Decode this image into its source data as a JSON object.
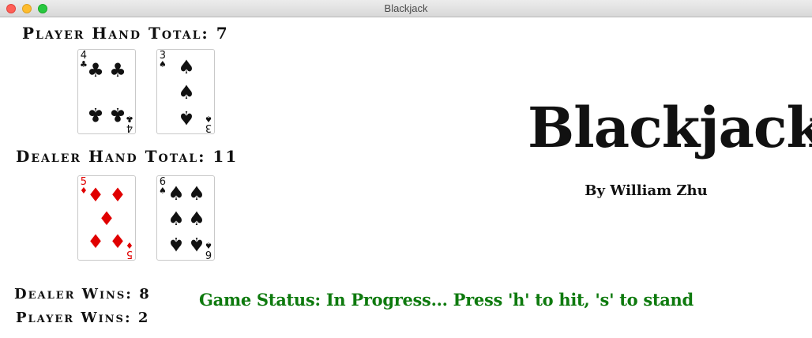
{
  "window": {
    "title": "Blackjack"
  },
  "player": {
    "total_label": "Player Hand Total: 7",
    "cards": [
      {
        "rank": "4",
        "suit": "♣",
        "color": "black"
      },
      {
        "rank": "3",
        "suit": "♠",
        "color": "black"
      }
    ]
  },
  "dealer": {
    "total_label": "Dealer Hand Total: 11",
    "cards": [
      {
        "rank": "5",
        "suit": "♦",
        "color": "red"
      },
      {
        "rank": "6",
        "suit": "♠",
        "color": "black"
      }
    ]
  },
  "score": {
    "dealer_wins": "Dealer Wins: 8",
    "player_wins": "Player Wins: 2"
  },
  "branding": {
    "title": "Blackjack",
    "byline": "By William Zhu"
  },
  "status": "Game Status: In Progress... Press 'h' to hit, 's' to stand",
  "colors": {
    "status": "#0e7a0e",
    "red_suit": "#e00000",
    "black_suit": "#111111"
  }
}
